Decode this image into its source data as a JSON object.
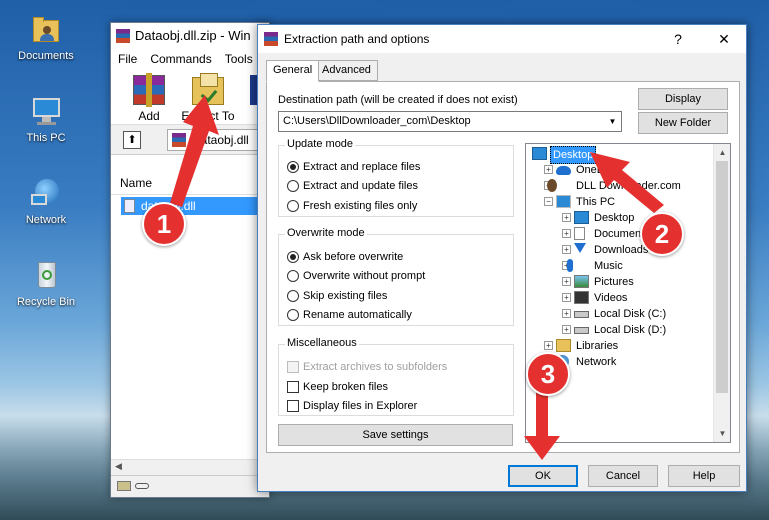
{
  "desktop": {
    "icons": [
      {
        "label": "Documents",
        "icon": "folder-user-icon"
      },
      {
        "label": "This PC",
        "icon": "computer-icon"
      },
      {
        "label": "Network",
        "icon": "network-icon"
      },
      {
        "label": "Recycle Bin",
        "icon": "recycle-bin-icon"
      }
    ]
  },
  "winrar": {
    "title": "Dataobj.dll.zip - Win",
    "menu": [
      "File",
      "Commands",
      "Tools"
    ],
    "toolbar": {
      "add_label": "Add",
      "extract_label": "Extract To"
    },
    "address": "Dataobj.dll",
    "list": {
      "column_name": "Name",
      "selected_file": "dataobj.dll"
    }
  },
  "dialog": {
    "title": "Extraction path and options",
    "help_glyph": "?",
    "close_glyph": "✕",
    "tabs": [
      "General",
      "Advanced"
    ],
    "destination_label": "Destination path (will be created if does not exist)",
    "destination_value": "C:\\Users\\DllDownloader_com\\Desktop",
    "display_button": "Display",
    "new_folder_button": "New Folder",
    "update_mode": {
      "title": "Update mode",
      "options": [
        "Extract and replace files",
        "Extract and update files",
        "Fresh existing files only"
      ],
      "selected": 0
    },
    "overwrite_mode": {
      "title": "Overwrite mode",
      "options": [
        "Ask before overwrite",
        "Overwrite without prompt",
        "Skip existing files",
        "Rename automatically"
      ],
      "selected": 0
    },
    "miscellaneous": {
      "title": "Miscellaneous",
      "options": [
        "Extract archives to subfolders",
        "Keep broken files",
        "Display files in Explorer"
      ],
      "disabled": [
        true,
        false,
        false
      ]
    },
    "save_settings": "Save settings",
    "tree": [
      {
        "label": "Desktop",
        "icon": "desktop-icon",
        "level": 0,
        "selected": true
      },
      {
        "label": "OneDrive",
        "icon": "onedrive-icon",
        "level": 1
      },
      {
        "label": "DLL Downloader.com",
        "icon": "user-icon",
        "level": 1
      },
      {
        "label": "This PC",
        "icon": "computer-icon",
        "level": 1
      },
      {
        "label": "Desktop",
        "icon": "desktop-icon",
        "level": 2
      },
      {
        "label": "Documents",
        "icon": "documents-icon",
        "level": 2
      },
      {
        "label": "Downloads",
        "icon": "downloads-icon",
        "level": 2
      },
      {
        "label": "Music",
        "icon": "music-icon",
        "level": 2
      },
      {
        "label": "Pictures",
        "icon": "pictures-icon",
        "level": 2
      },
      {
        "label": "Videos",
        "icon": "videos-icon",
        "level": 2
      },
      {
        "label": "Local Disk (C:)",
        "icon": "drive-icon",
        "level": 2
      },
      {
        "label": "Local Disk (D:)",
        "icon": "drive-icon",
        "level": 2
      },
      {
        "label": "Libraries",
        "icon": "libraries-icon",
        "level": 1
      },
      {
        "label": "Network",
        "icon": "network-icon",
        "level": 1
      }
    ],
    "ok_button": "OK",
    "cancel_button": "Cancel",
    "help_button": "Help"
  },
  "callouts": [
    "1",
    "2",
    "3"
  ],
  "colors": {
    "accent": "#0078d7",
    "selection": "#3399ff",
    "callout": "#e53030"
  }
}
